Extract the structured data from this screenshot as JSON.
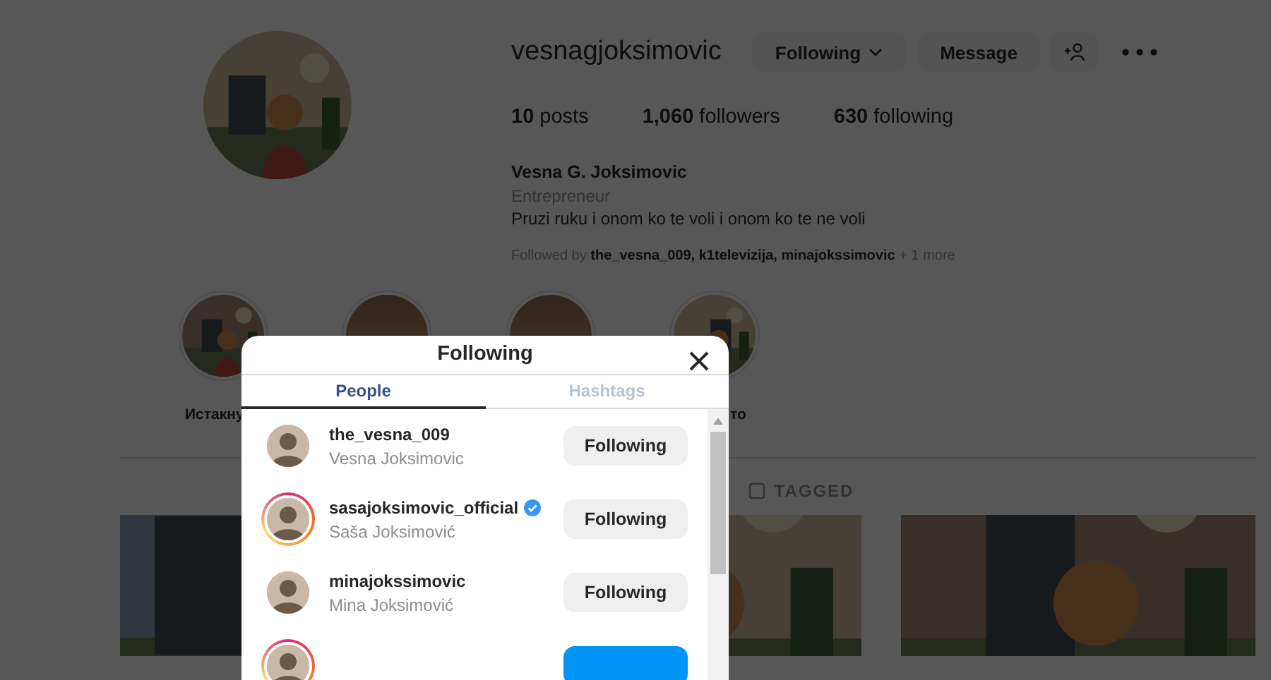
{
  "profile": {
    "username": "vesnagjoksimovic",
    "follow_button": "Following",
    "message_button": "Message",
    "stats": [
      {
        "count": "10",
        "label": "posts"
      },
      {
        "count": "1,060",
        "label": "followers"
      },
      {
        "count": "630",
        "label": "following"
      }
    ],
    "full_name": "Vesna G. Joksimovic",
    "category": "Entrepreneur",
    "bio": "Pruzi ruku i onom ko te voli i onom ko te ne voli",
    "followed_by": {
      "prefix": "Followed by",
      "names": "the_vesna_009, k1televizija, minajokssimovic",
      "suffix": "+ 1 more"
    }
  },
  "highlights": [
    {
      "kind": "labeled",
      "label": "Истакну"
    },
    {
      "kind": "covered"
    },
    {
      "kind": "covered"
    },
    {
      "kind": "labeled",
      "label": "то"
    }
  ],
  "tagged_tab": "TAGGED",
  "modal": {
    "title": "Following",
    "tabs": [
      {
        "label": "People",
        "selected": true
      },
      {
        "label": "Hashtags",
        "selected": false
      }
    ],
    "rows": [
      {
        "username": "the_vesna_009",
        "name": "Vesna Joksimovic",
        "verified": false,
        "story_ring": false,
        "following": true,
        "button": "Following"
      },
      {
        "username": "sasajoksimovic_official",
        "name": "Saša Joksimović",
        "verified": true,
        "story_ring": true,
        "following": true,
        "button": "Following"
      },
      {
        "username": "minajokssimovic",
        "name": "Mina Joksimović",
        "verified": false,
        "story_ring": false,
        "following": true,
        "button": "Following"
      },
      {
        "story_ring": true,
        "following": false
      }
    ]
  }
}
